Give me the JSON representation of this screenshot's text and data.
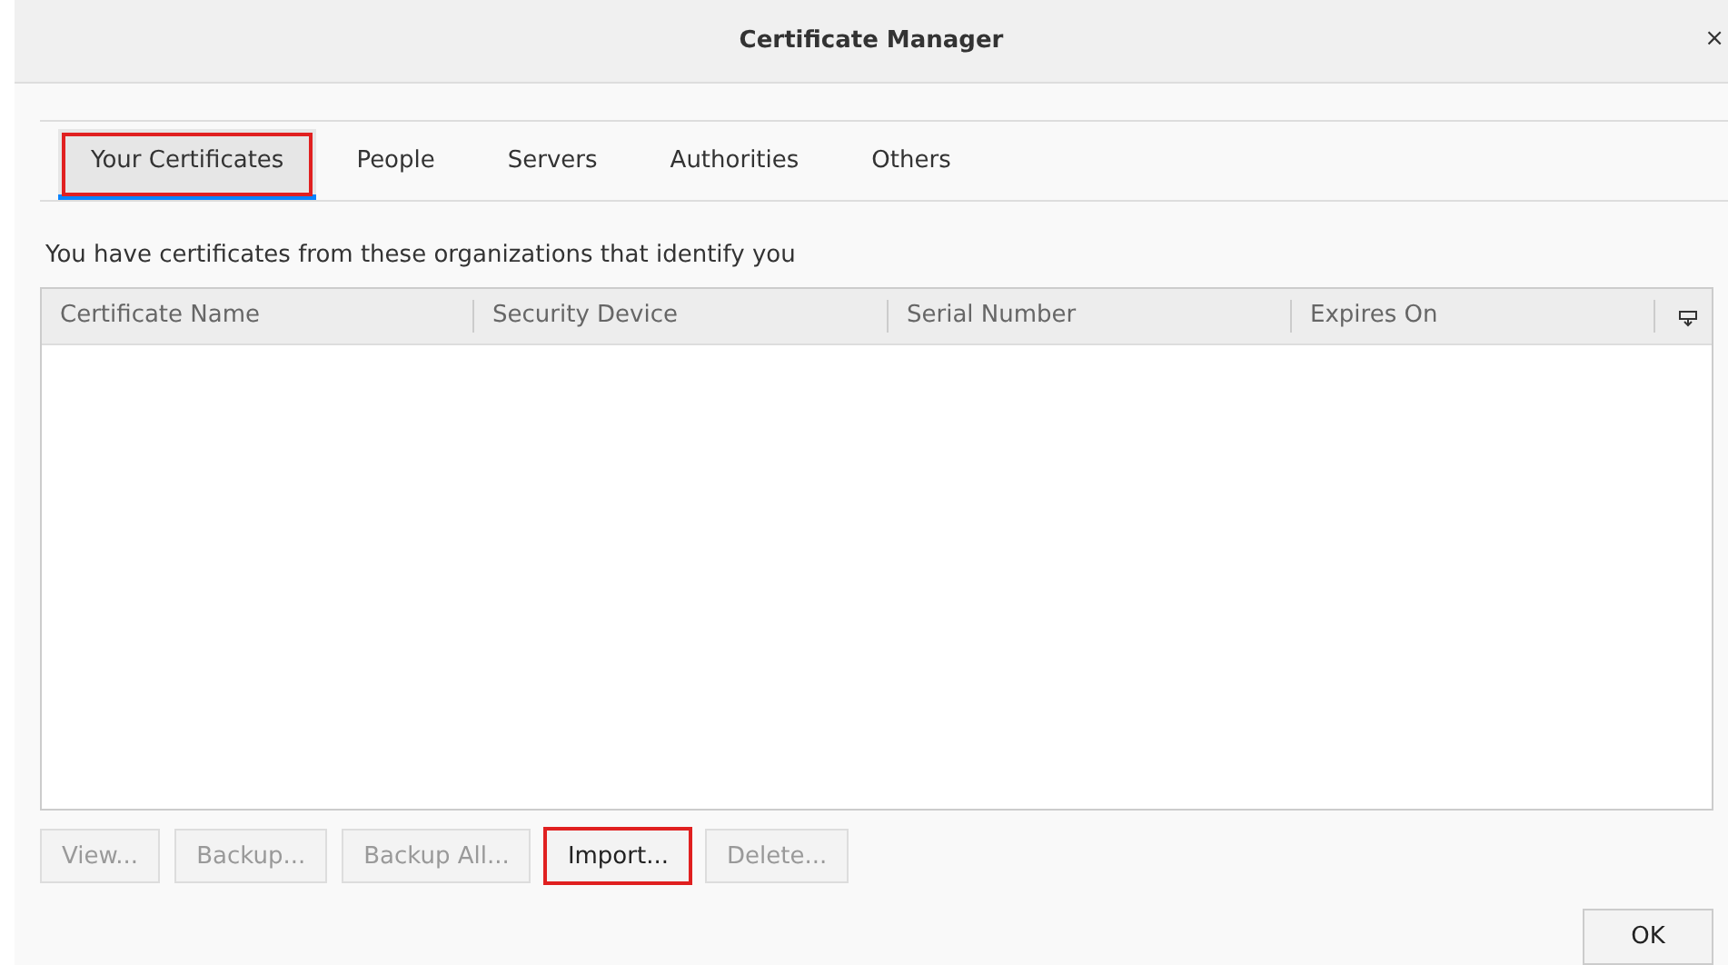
{
  "window": {
    "title": "Certificate Manager",
    "close": "×"
  },
  "tabs": [
    {
      "label": "Your Certificates",
      "selected": true,
      "highlighted": true
    },
    {
      "label": "People",
      "selected": false,
      "highlighted": false
    },
    {
      "label": "Servers",
      "selected": false,
      "highlighted": false
    },
    {
      "label": "Authorities",
      "selected": false,
      "highlighted": false
    },
    {
      "label": "Others",
      "selected": false,
      "highlighted": false
    }
  ],
  "description": "You have certificates from these organizations that identify you",
  "table": {
    "columns": [
      "Certificate Name",
      "Security Device",
      "Serial Number",
      "Expires On"
    ]
  },
  "buttons": [
    {
      "label": "View...",
      "disabled": true,
      "highlighted": false
    },
    {
      "label": "Backup...",
      "disabled": true,
      "highlighted": false
    },
    {
      "label": "Backup All...",
      "disabled": true,
      "highlighted": false
    },
    {
      "label": "Import...",
      "disabled": false,
      "highlighted": true
    },
    {
      "label": "Delete...",
      "disabled": true,
      "highlighted": false
    }
  ],
  "ok_button": "OK"
}
